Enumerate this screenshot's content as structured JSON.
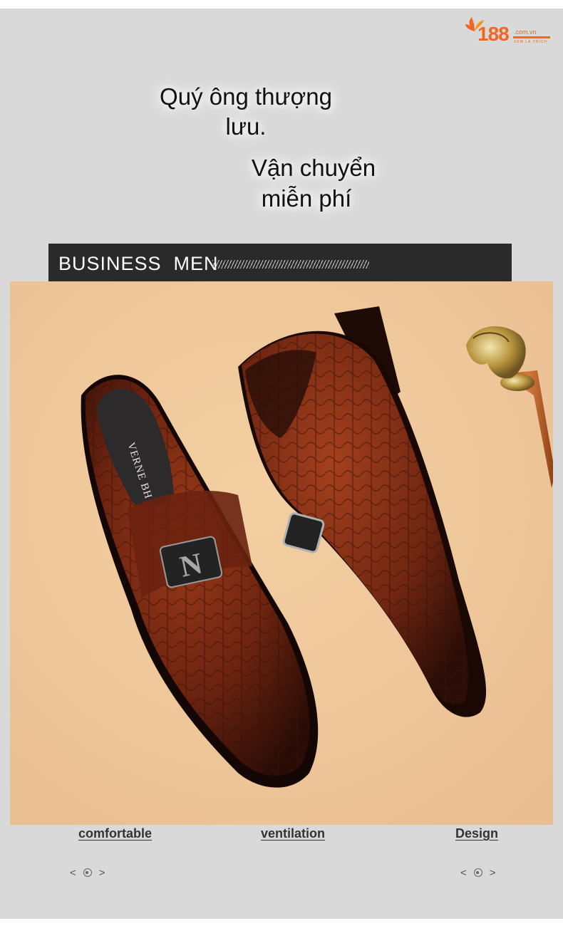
{
  "logo": {
    "number": "188",
    "domain": ".com.vn",
    "tagline": "XEM LÀ THÍCH"
  },
  "headline": {
    "line1a": "Quý ông thượng",
    "line1b": "lưu.",
    "line2a": "Vận chuyển",
    "line2b": "miễn phí"
  },
  "banner": {
    "text": "BUSINESS  MEN"
  },
  "photo": {
    "insole_brand": "VERNE BH",
    "buckle_letter": "N"
  },
  "features": [
    {
      "label": "comfortable"
    },
    {
      "label": "ventilation"
    },
    {
      "label": "Design"
    }
  ],
  "carousel": {
    "prev": "<",
    "next": ">"
  },
  "colors": {
    "brand": "#f26522",
    "banner_bg": "#2a2a2a",
    "panel_bg": "#d9d9d9",
    "photo_bg": "#eec69a"
  }
}
